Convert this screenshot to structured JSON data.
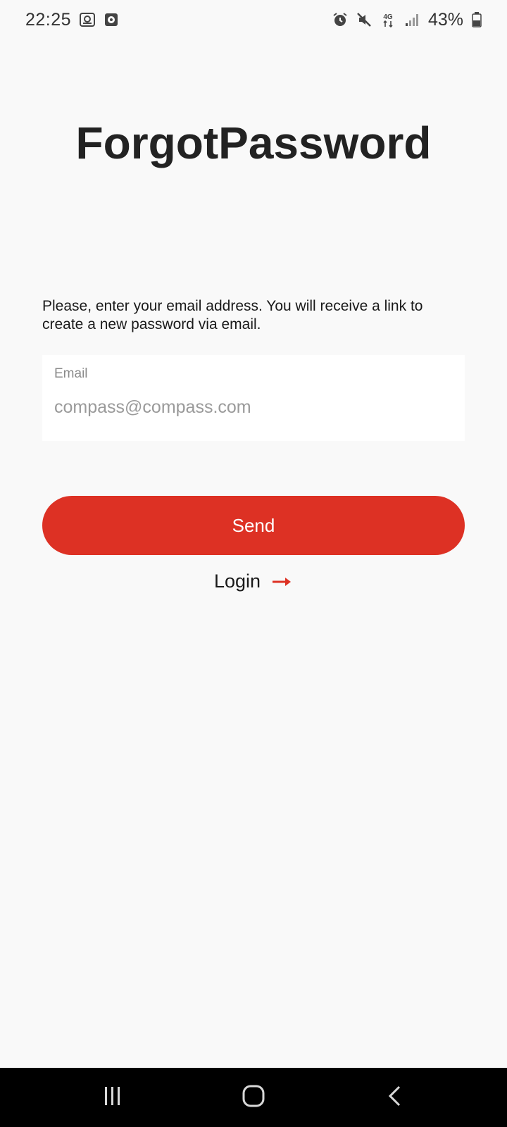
{
  "status_bar": {
    "time": "22:25",
    "battery": "43%",
    "network": "4G",
    "icons": [
      "voicemail-icon",
      "media-icon",
      "alarm-icon",
      "mute-icon",
      "network-4g-icon",
      "signal-icon",
      "battery-icon"
    ]
  },
  "page": {
    "title": "ForgotPassword",
    "instructions": "Please, enter your email address. You will receive a link to create a new password via email."
  },
  "email_field": {
    "label": "Email",
    "value": "",
    "placeholder": "compass@compass.com"
  },
  "actions": {
    "send_label": "Send",
    "login_label": "Login"
  },
  "colors": {
    "accent": "#dd3124",
    "background": "#f9f9f9",
    "text": "#222222"
  },
  "nav_bar": {
    "icons": [
      "recent-apps-icon",
      "home-icon",
      "back-icon"
    ]
  }
}
